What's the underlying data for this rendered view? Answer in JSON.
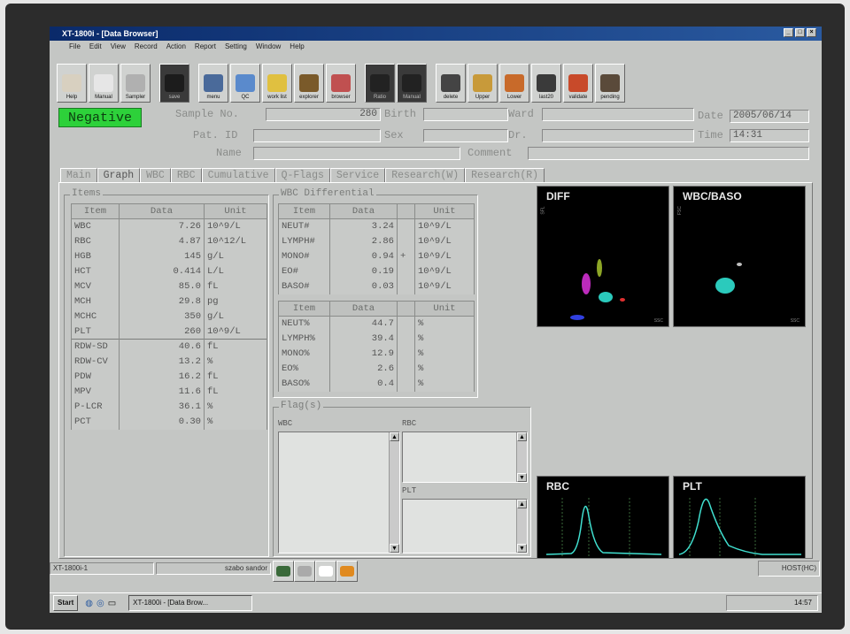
{
  "window": {
    "title": "XT-1800i - [Data Browser]"
  },
  "menu": [
    "File",
    "Edit",
    "View",
    "Record",
    "Action",
    "Report",
    "Setting",
    "Window",
    "Help"
  ],
  "toolbar": [
    {
      "label": "Help",
      "icon": "help-icon",
      "color": "#d8d0c0",
      "dark": false
    },
    {
      "label": "Manual",
      "icon": "manual-icon",
      "color": "#e6e6e6",
      "dark": false
    },
    {
      "label": "Sampler",
      "icon": "sampler-icon",
      "color": "#b0b0b0",
      "dark": false
    },
    {
      "label": "save",
      "icon": "save-icon",
      "color": "#1c1c1c",
      "dark": true
    },
    {
      "label": "menu",
      "icon": "menu-icon",
      "color": "#4a6a9a",
      "dark": false
    },
    {
      "label": "QC",
      "icon": "qc-icon",
      "color": "#5a8acc",
      "dark": false
    },
    {
      "label": "work list",
      "icon": "work-list-icon",
      "color": "#e0c040",
      "dark": false
    },
    {
      "label": "explorer",
      "icon": "explorer-icon",
      "color": "#7a5a2a",
      "dark": false
    },
    {
      "label": "browser",
      "icon": "browser-icon",
      "color": "#c05050",
      "dark": false
    },
    {
      "label": "Ratio",
      "icon": "ratio-icon",
      "color": "#222",
      "dark": true
    },
    {
      "label": "Manual",
      "icon": "manual-run-icon",
      "color": "#222",
      "dark": true
    },
    {
      "label": "delete",
      "icon": "delete-icon",
      "color": "#444",
      "dark": false
    },
    {
      "label": "Upper",
      "icon": "upper-icon",
      "color": "#c89a3a",
      "dark": false
    },
    {
      "label": "Lower",
      "icon": "lower-icon",
      "color": "#c86a2a",
      "dark": false
    },
    {
      "label": "last20",
      "icon": "last20-icon",
      "color": "#3a3a3a",
      "dark": false
    },
    {
      "label": "validate",
      "icon": "validate-icon",
      "color": "#c84a2a",
      "dark": false
    },
    {
      "label": "pending",
      "icon": "pending-icon",
      "color": "#5a4a3a",
      "dark": false
    }
  ],
  "header": {
    "result": "Negative",
    "sample_no_label": "Sample No.",
    "sample_no": "280",
    "birth_label": "Birth",
    "birth": "",
    "ward_label": "Ward",
    "ward": "",
    "date_label": "Date",
    "date": "2005/06/14",
    "pat_id_label": "Pat. ID",
    "pat_id": "",
    "sex_label": "Sex",
    "sex": "",
    "dr_label": "Dr.",
    "dr": "",
    "time_label": "Time",
    "time": "14:31",
    "name_label": "Name",
    "name": "",
    "comment_label": "Comment",
    "comment": ""
  },
  "tabs": [
    "Main",
    "Graph",
    "WBC",
    "RBC",
    "Cumulative",
    "Q-Flags",
    "Service",
    "Research(W)",
    "Research(R)"
  ],
  "active_tab": "Graph",
  "items": {
    "title": "Items",
    "headers": [
      "Item",
      "Data",
      "Unit"
    ],
    "rows": [
      [
        "WBC",
        "7.26",
        "10^9/L"
      ],
      [
        "RBC",
        "4.87",
        "10^12/L"
      ],
      [
        "HGB",
        "145",
        "g/L"
      ],
      [
        "HCT",
        "0.414",
        "L/L"
      ],
      [
        "MCV",
        "85.0",
        "fL"
      ],
      [
        "MCH",
        "29.8",
        "pg"
      ],
      [
        "MCHC",
        "350",
        "g/L"
      ],
      [
        "PLT",
        "260",
        "10^9/L"
      ],
      [
        "RDW-SD",
        "40.6",
        "fL"
      ],
      [
        "RDW-CV",
        "13.2",
        "%"
      ],
      [
        "PDW",
        "16.2",
        "fL"
      ],
      [
        "MPV",
        "11.6",
        "fL"
      ],
      [
        "P-LCR",
        "36.1",
        "%"
      ],
      [
        "PCT",
        "0.30",
        "%"
      ]
    ]
  },
  "wbc_diff": {
    "title": "WBC Differential",
    "headers": [
      "Item",
      "Data",
      "",
      "Unit"
    ],
    "abs_rows": [
      [
        "NEUT#",
        "3.24",
        "",
        "10^9/L"
      ],
      [
        "LYMPH#",
        "2.86",
        "",
        "10^9/L"
      ],
      [
        "MONO#",
        "0.94",
        "+",
        "10^9/L"
      ],
      [
        "EO#",
        "0.19",
        "",
        "10^9/L"
      ],
      [
        "BASO#",
        "0.03",
        "",
        "10^9/L"
      ]
    ],
    "pct_rows": [
      [
        "NEUT%",
        "44.7",
        "",
        "%"
      ],
      [
        "LYMPH%",
        "39.4",
        "",
        "%"
      ],
      [
        "MONO%",
        "12.9",
        "",
        "%"
      ],
      [
        "EO%",
        "2.6",
        "",
        "%"
      ],
      [
        "BASO%",
        "0.4",
        "",
        "%"
      ]
    ]
  },
  "flags": {
    "title": "Flag(s)",
    "wbc": "WBC",
    "rbc": "RBC",
    "plt": "PLT"
  },
  "plots": {
    "diff": "DIFF",
    "wbc_baso": "WBC/BASO",
    "rbc": "RBC",
    "plt": "PLT",
    "sfl": "SFL",
    "ssc": "SSC",
    "fsc": "FSC"
  },
  "status": {
    "instrument": "XT-1800i-1",
    "user": "szabo sandor",
    "host": "HOST(HC)"
  },
  "taskbar": {
    "start": "Start",
    "task": "XT-1800i - [Data Brow...",
    "clock": "14:57"
  }
}
